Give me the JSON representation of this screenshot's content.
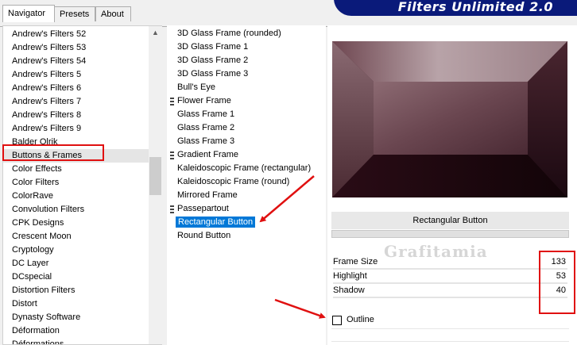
{
  "tabs": [
    {
      "label": "Navigator"
    },
    {
      "label": "Presets"
    },
    {
      "label": "About"
    }
  ],
  "banner": {
    "title": "Filters Unlimited 2.0",
    "color": "#0a1a7a"
  },
  "categories": [
    {
      "label": "Andrew's Filters 52"
    },
    {
      "label": "Andrew's Filters 53"
    },
    {
      "label": "Andrew's Filters 54"
    },
    {
      "label": "Andrew's Filters 5"
    },
    {
      "label": "Andrew's Filters 6"
    },
    {
      "label": "Andrew's Filters 7"
    },
    {
      "label": "Andrew's Filters 8"
    },
    {
      "label": "Andrew's Filters 9"
    },
    {
      "label": "Balder Olrik"
    },
    {
      "label": "Buttons & Frames",
      "selected": true
    },
    {
      "label": "Color Effects"
    },
    {
      "label": "Color Filters"
    },
    {
      "label": "ColorRave"
    },
    {
      "label": "Convolution Filters"
    },
    {
      "label": "CPK Designs"
    },
    {
      "label": "Crescent Moon"
    },
    {
      "label": "Cryptology"
    },
    {
      "label": "DC Layer"
    },
    {
      "label": "DCspecial"
    },
    {
      "label": "Distortion Filters"
    },
    {
      "label": "Distort"
    },
    {
      "label": "Dynasty Software"
    },
    {
      "label": "Déformation"
    },
    {
      "label": "Déformations"
    }
  ],
  "filters": [
    {
      "label": "3D Glass Frame (rounded)",
      "grip": false
    },
    {
      "label": "3D Glass Frame 1",
      "grip": false
    },
    {
      "label": "3D Glass Frame 2",
      "grip": false
    },
    {
      "label": "3D Glass Frame 3",
      "grip": false
    },
    {
      "label": "Bull's Eye",
      "grip": false
    },
    {
      "label": "Flower Frame",
      "grip": true
    },
    {
      "label": "Glass Frame 1",
      "grip": false
    },
    {
      "label": "Glass Frame 2",
      "grip": false
    },
    {
      "label": "Glass Frame 3",
      "grip": false
    },
    {
      "label": "Gradient Frame",
      "grip": true
    },
    {
      "label": "Kaleidoscopic Frame (rectangular)",
      "grip": false
    },
    {
      "label": "Kaleidoscopic Frame (round)",
      "grip": false
    },
    {
      "label": "Mirrored Frame",
      "grip": false
    },
    {
      "label": "Passepartout",
      "grip": true
    },
    {
      "label": "Rectangular Button",
      "grip": false,
      "selected": true
    },
    {
      "label": "Round Button",
      "grip": false
    }
  ],
  "preview": {
    "filter_name": "Rectangular Button"
  },
  "params": [
    {
      "label": "Frame Size",
      "value": "133"
    },
    {
      "label": "Highlight",
      "value": "53"
    },
    {
      "label": "Shadow",
      "value": "40"
    }
  ],
  "outline": {
    "label": "Outline",
    "checked": false
  },
  "watermark": {
    "text": "Grafitamia"
  },
  "colors": {
    "selection": "#0078d7",
    "annotation": "#e01010"
  }
}
